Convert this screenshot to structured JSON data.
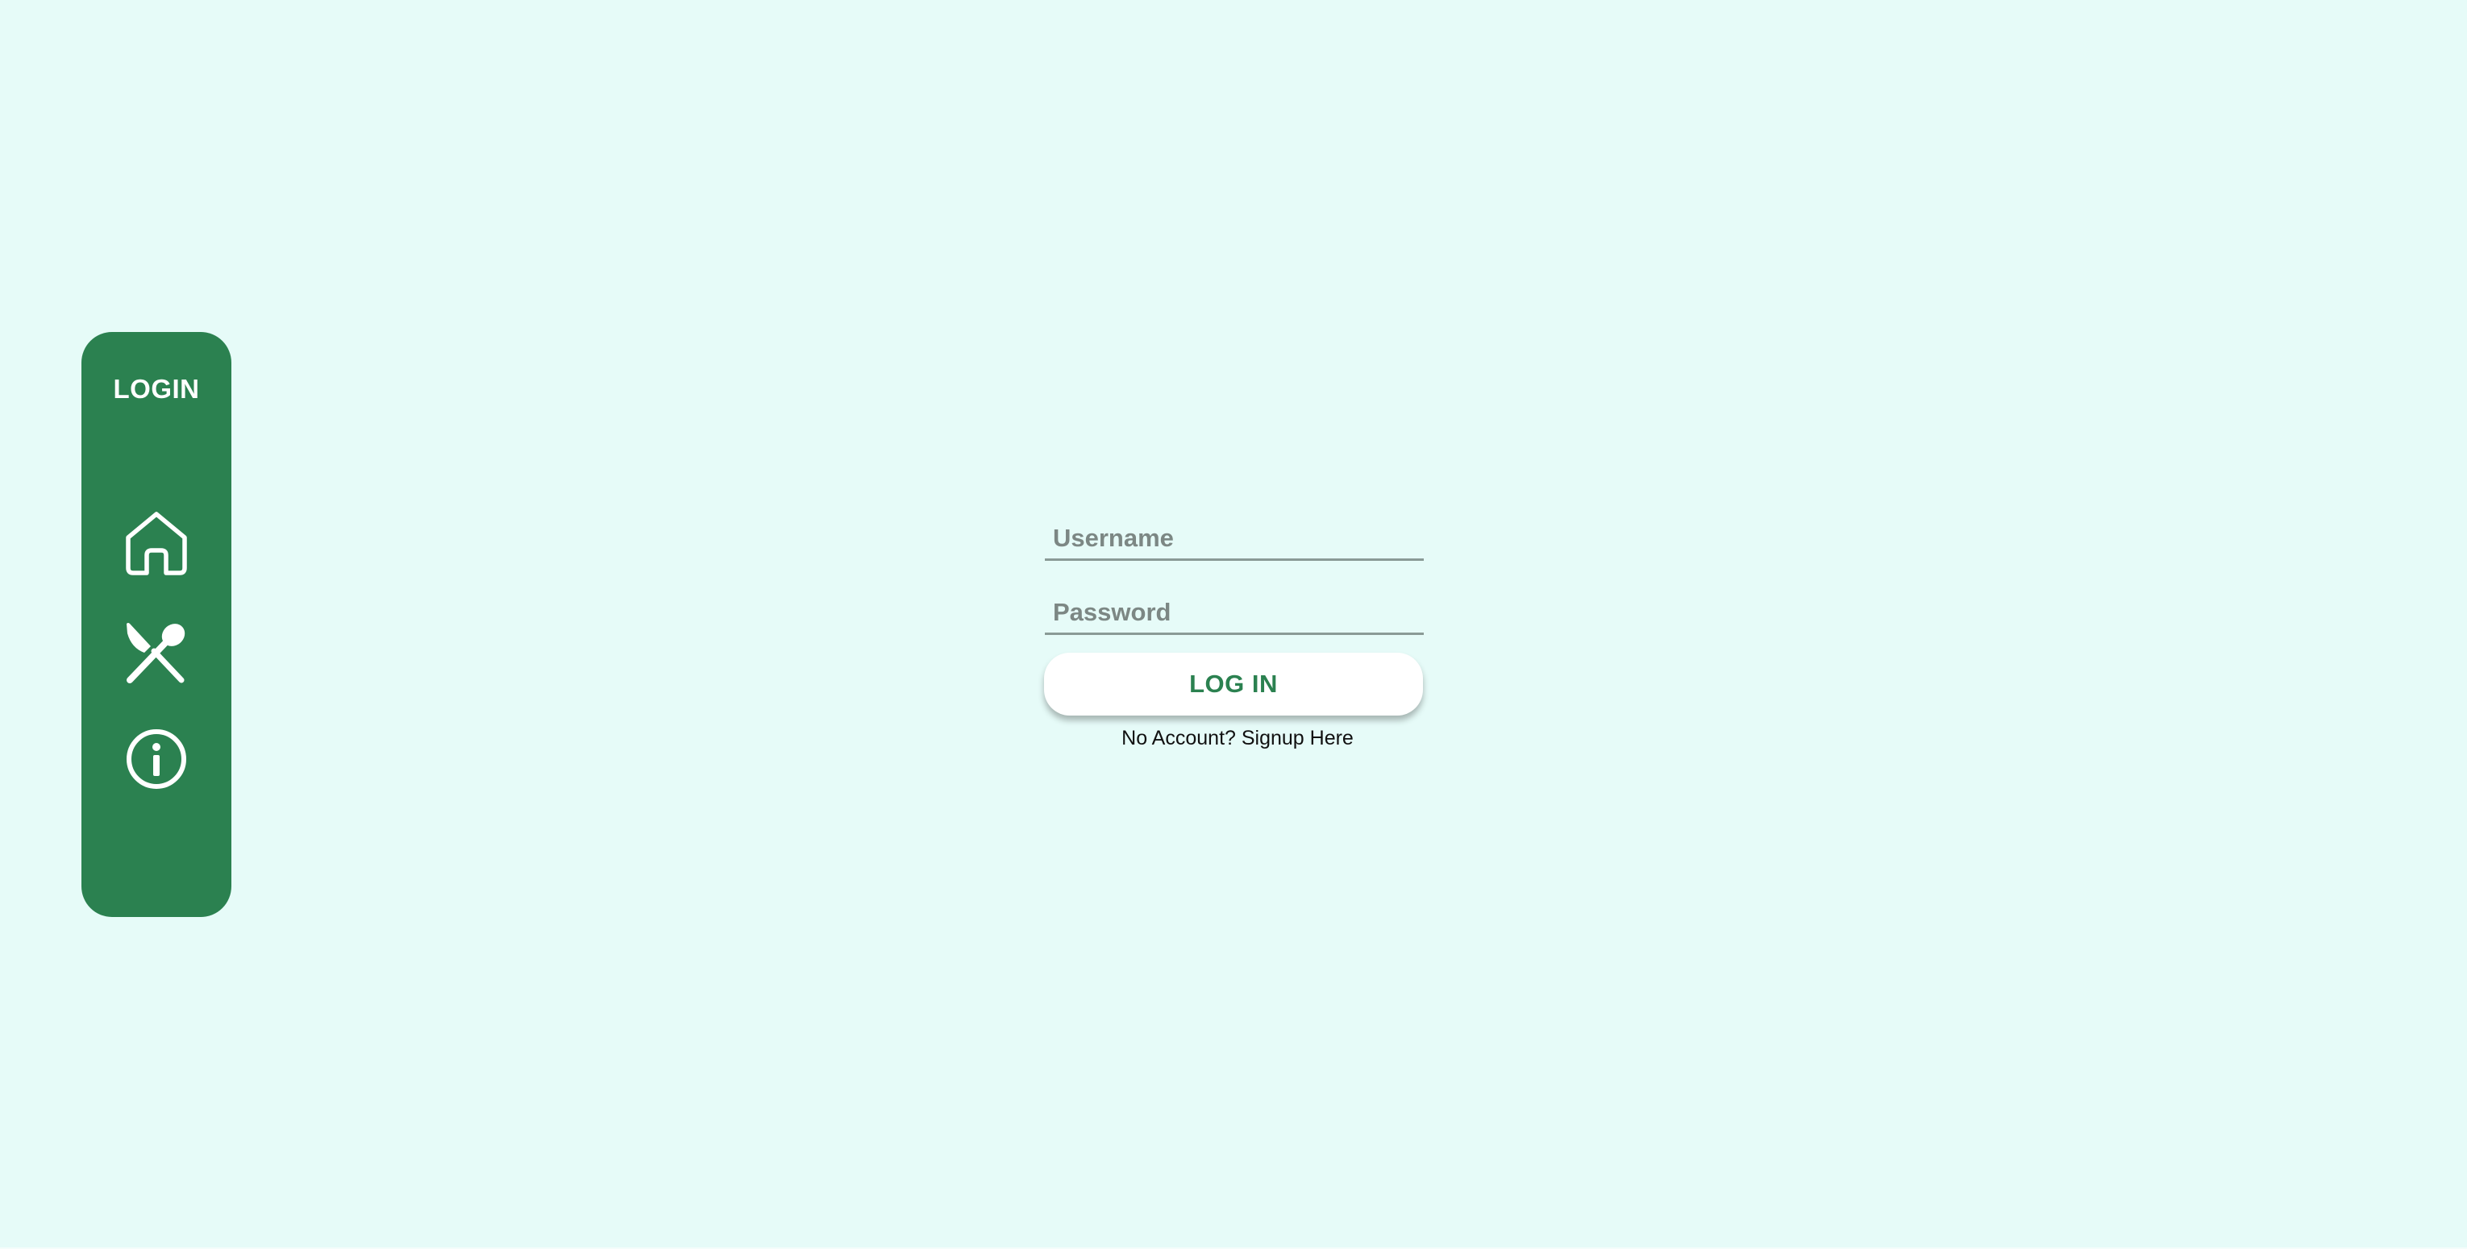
{
  "sidebar": {
    "login_label": "LOGIN",
    "items": [
      {
        "icon": "home-icon"
      },
      {
        "icon": "fork-spoon-icon"
      },
      {
        "icon": "info-icon"
      }
    ],
    "color": "#2b8150"
  },
  "form": {
    "username_placeholder": "Username",
    "username_value": "",
    "password_placeholder": "Password",
    "password_value": "",
    "login_button_label": "LOG IN",
    "signup_text": "No Account? Signup Here"
  },
  "colors": {
    "background": "#e6fbf8",
    "accent": "#2b8150",
    "button_bg": "#ffffff"
  }
}
